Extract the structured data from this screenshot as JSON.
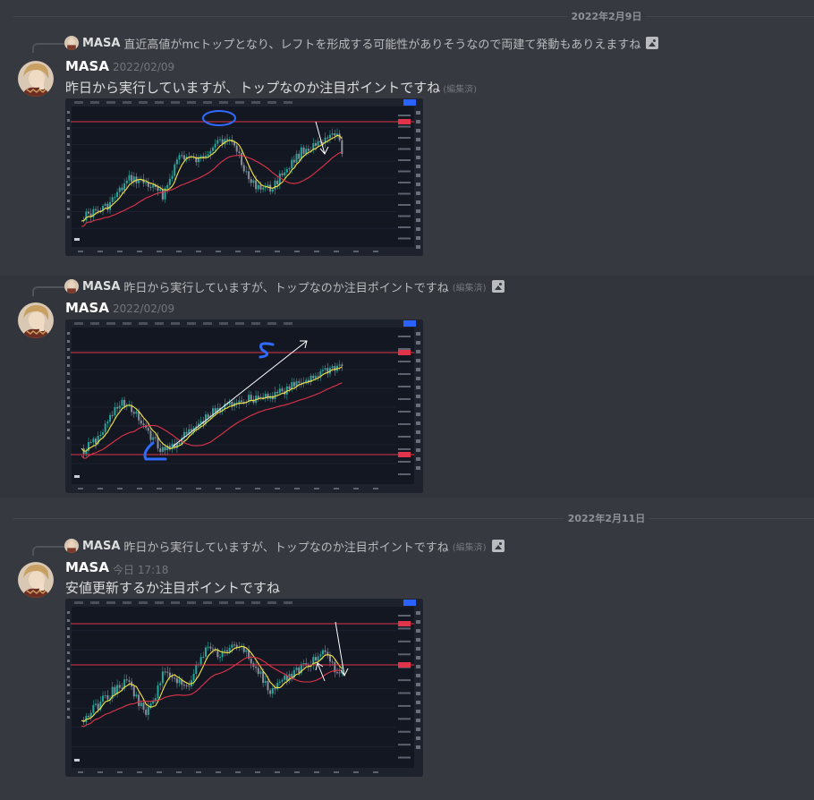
{
  "dividers": [
    {
      "label": "2022年2月9日"
    },
    {
      "label": "2022年2月11日"
    }
  ],
  "messages": [
    {
      "reply": {
        "author": "MASA",
        "text": "直近高値がmcトップとなり、レフトを形成する可能性がありそうなので両建て発動もありえますね",
        "edited": "",
        "icon": "image-icon"
      },
      "author": "MASA",
      "timestamp": "2022/02/09",
      "text": "昨日から実行していますが、トップなのか注目ポイントですね",
      "edited": "(編集済)",
      "attachment": "trading-chart-image"
    },
    {
      "reply": {
        "author": "MASA",
        "text": "昨日から実行していますが、トップなのか注目ポイントですね",
        "edited": "(編集済)",
        "icon": "image-icon"
      },
      "author": "MASA",
      "timestamp": "2022/02/09",
      "text": "",
      "edited": "",
      "attachment": "trading-chart-image"
    },
    {
      "reply": {
        "author": "MASA",
        "text": "昨日から実行していますが、トップなのか注目ポイントですね",
        "edited": "(編集済)",
        "icon": "image-icon"
      },
      "author": "MASA",
      "timestamp": "今日 17:18",
      "text": "安値更新するか注目ポイントですね",
      "edited": "",
      "attachment": "trading-chart-image"
    }
  ],
  "colors": {
    "background": "#36393f",
    "chart_bg": "#131722",
    "ma_fast": "#f5e642",
    "ma_slow": "#e0344a",
    "drawing": "#2f6bff",
    "arrow": "#ffffff",
    "hline": "#e0344a"
  }
}
